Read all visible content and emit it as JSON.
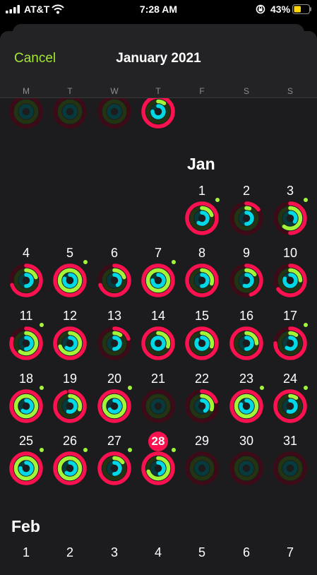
{
  "status_bar": {
    "carrier": "AT&T",
    "time": "7:28 AM",
    "battery_percent": "43%",
    "icons": [
      "signal-icon",
      "wifi-icon",
      "orientation-lock-icon",
      "battery-icon"
    ]
  },
  "nav": {
    "cancel_label": "Cancel",
    "title": "January 2021"
  },
  "weekdays": [
    "M",
    "T",
    "W",
    "T",
    "F",
    "S",
    "S"
  ],
  "colors": {
    "move": "#fa114f",
    "move_track": "#3d0a17",
    "exercise": "#a3f53a",
    "exercise_track": "#223411",
    "stand": "#00d8e6",
    "stand_track": "#073a3c",
    "accent": "#a3e635"
  },
  "previous_rows": [
    {
      "col": 0,
      "rings": [
        0,
        0,
        0
      ]
    },
    {
      "col": 1,
      "rings": [
        0,
        0,
        0
      ]
    },
    {
      "col": 2,
      "rings": [
        0,
        0,
        0
      ]
    },
    {
      "col": 3,
      "rings": [
        1,
        0.1,
        0.75
      ]
    }
  ],
  "months": [
    {
      "label": "Jan",
      "days": [
        {
          "day": "1",
          "col": 4,
          "rings": [
            1,
            0.2,
            0.6
          ],
          "dot": true
        },
        {
          "day": "2",
          "col": 5,
          "rings": [
            0.15,
            0.05,
            0.5
          ],
          "dot": false
        },
        {
          "day": "3",
          "col": 6,
          "rings": [
            0.5,
            0.6,
            0.35
          ],
          "dot": true
        },
        {
          "day": "4",
          "col": 0,
          "rings": [
            0.7,
            0.2,
            0.5
          ],
          "dot": false
        },
        {
          "day": "5",
          "col": 1,
          "rings": [
            1,
            1,
            0.8
          ],
          "dot": true
        },
        {
          "day": "6",
          "col": 2,
          "rings": [
            0.7,
            0.2,
            0.4
          ],
          "dot": false
        },
        {
          "day": "7",
          "col": 3,
          "rings": [
            1,
            1,
            0.75
          ],
          "dot": true
        },
        {
          "day": "8",
          "col": 4,
          "rings": [
            1,
            0.3,
            0.5
          ],
          "dot": false
        },
        {
          "day": "9",
          "col": 5,
          "rings": [
            0.45,
            0.15,
            0.55
          ],
          "dot": false
        },
        {
          "day": "10",
          "col": 6,
          "rings": [
            0.65,
            0.25,
            0.8
          ],
          "dot": false
        },
        {
          "day": "11",
          "col": 0,
          "rings": [
            0.8,
            0.6,
            0.5
          ],
          "dot": true
        },
        {
          "day": "12",
          "col": 1,
          "rings": [
            1,
            0.7,
            0.6
          ],
          "dot": false
        },
        {
          "day": "13",
          "col": 2,
          "rings": [
            0.2,
            0.1,
            0.5
          ],
          "dot": false
        },
        {
          "day": "14",
          "col": 3,
          "rings": [
            1,
            0.3,
            1
          ],
          "dot": false
        },
        {
          "day": "15",
          "col": 4,
          "rings": [
            1,
            0.3,
            0.85
          ],
          "dot": false
        },
        {
          "day": "16",
          "col": 5,
          "rings": [
            1,
            0.25,
            0.5
          ],
          "dot": false
        },
        {
          "day": "17",
          "col": 6,
          "rings": [
            0.75,
            0.1,
            0.6
          ],
          "dot": true
        },
        {
          "day": "18",
          "col": 0,
          "rings": [
            1,
            1,
            0.6
          ],
          "dot": true
        },
        {
          "day": "19",
          "col": 1,
          "rings": [
            0.95,
            0.3,
            0.55
          ],
          "dot": false
        },
        {
          "day": "20",
          "col": 2,
          "rings": [
            1,
            1,
            0.65
          ],
          "dot": true
        },
        {
          "day": "21",
          "col": 3,
          "rings": [
            0,
            0,
            0
          ],
          "dot": false
        },
        {
          "day": "22",
          "col": 4,
          "rings": [
            0.2,
            0.3,
            0.4
          ],
          "dot": false
        },
        {
          "day": "23",
          "col": 5,
          "rings": [
            1,
            1,
            0.8
          ],
          "dot": true
        },
        {
          "day": "24",
          "col": 6,
          "rings": [
            1,
            0.1,
            0.55
          ],
          "dot": true
        },
        {
          "day": "25",
          "col": 0,
          "rings": [
            1,
            1,
            0.75
          ],
          "dot": true
        },
        {
          "day": "26",
          "col": 1,
          "rings": [
            1,
            1,
            0.6
          ],
          "dot": true
        },
        {
          "day": "27",
          "col": 2,
          "rings": [
            1,
            0.15,
            0.5
          ],
          "dot": true
        },
        {
          "day": "28",
          "col": 3,
          "rings": [
            1,
            0.7,
            0.45
          ],
          "dot": true,
          "today": true
        },
        {
          "day": "29",
          "col": 4,
          "rings": [
            0,
            0,
            0
          ],
          "dot": false
        },
        {
          "day": "30",
          "col": 5,
          "rings": [
            0,
            0,
            0
          ],
          "dot": false
        },
        {
          "day": "31",
          "col": 6,
          "rings": [
            0,
            0,
            0
          ],
          "dot": false
        }
      ]
    },
    {
      "label": "Feb",
      "days": [
        {
          "day": "1",
          "col": 0
        },
        {
          "day": "2",
          "col": 1
        },
        {
          "day": "3",
          "col": 2
        },
        {
          "day": "4",
          "col": 3
        },
        {
          "day": "5",
          "col": 4
        },
        {
          "day": "6",
          "col": 5
        },
        {
          "day": "7",
          "col": 6
        }
      ]
    }
  ]
}
